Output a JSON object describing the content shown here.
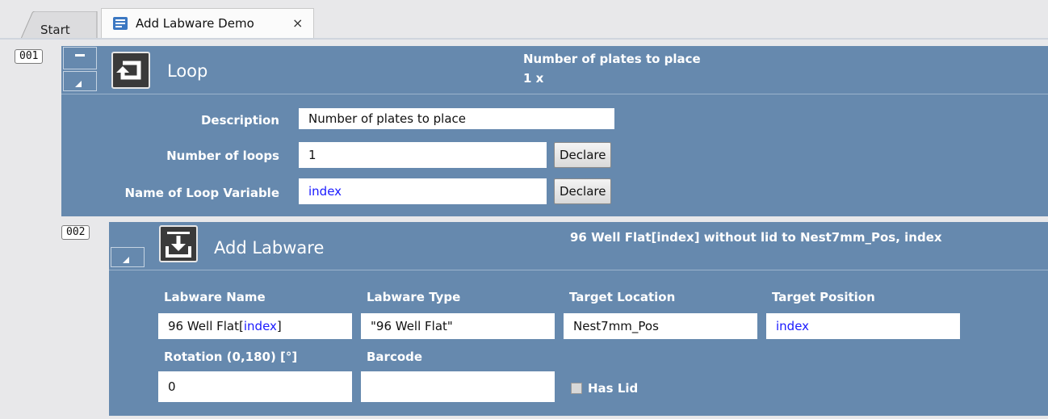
{
  "tabs": {
    "start_label": "Start",
    "active_label": "Add Labware Demo",
    "close_glyph": "×"
  },
  "steps": [
    {
      "number": "001",
      "title": "Loop",
      "summary_line1": "Number of plates to place",
      "summary_line2": "1 x",
      "icon": "loop-icon",
      "fields": {
        "description_label": "Description",
        "description_value": "Number of plates to place",
        "loops_label": "Number of loops",
        "loops_value": "1",
        "loopvar_label": "Name of Loop Variable",
        "loopvar_value": "index",
        "declare_label": "Declare"
      }
    },
    {
      "number": "002",
      "title": "Add Labware",
      "summary": "96 Well Flat[index] without lid to Nest7mm_Pos, index",
      "icon": "add-labware-icon",
      "fields": {
        "labware_name_label": "Labware Name",
        "labware_name_prefix": "96 Well Flat[",
        "labware_name_var": "index",
        "labware_name_suffix": "]",
        "labware_type_label": "Labware Type",
        "labware_type_value": "\"96 Well Flat\"",
        "target_location_label": "Target Location",
        "target_location_value": "Nest7mm_Pos",
        "target_position_label": "Target Position",
        "target_position_value": "index",
        "rotation_label": "Rotation (0,180) [°]",
        "rotation_value": "0",
        "barcode_label": "Barcode",
        "barcode_value": "",
        "has_lid_label": "Has Lid",
        "has_lid_checked": false
      }
    }
  ],
  "colors": {
    "panel": "#6689ae",
    "variable_text": "#1a1aff"
  }
}
